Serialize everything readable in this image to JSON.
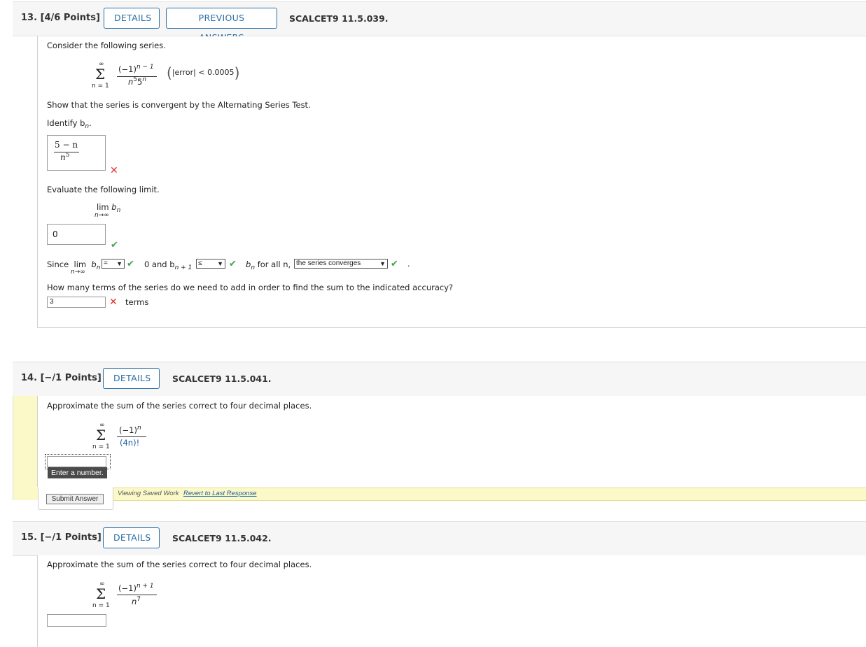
{
  "q13": {
    "number": "13.",
    "points": "[4/6 Points]",
    "details_label": "DETAILS",
    "prev_label": "PREVIOUS ANSWERS",
    "code": "SCALCET9 11.5.039.",
    "consider": "Consider the following series.",
    "series_num": "(−1)",
    "series_num_exp": "n − 1",
    "series_den": "n",
    "series_den_exp1": "5",
    "series_den_mid": "5",
    "series_den_exp2": "n",
    "sum_top": "∞",
    "sum_bottom": "n = 1",
    "error_text": "|error| < 0.0005",
    "show_text": "Show that the series is convergent by the Alternating Series Test.",
    "identify": "Identify b",
    "identify_sub": "n",
    "answer_bn_num": "5 − n",
    "answer_bn_den": "n",
    "answer_bn_den_exp": "5",
    "evaluate": "Evaluate the following limit.",
    "lim_word": "lim",
    "lim_b": "b",
    "lim_sub": "n",
    "lim_under": "n→∞",
    "limit_value": "0",
    "since": "Since",
    "since_lim": "lim",
    "since_b": "b",
    "since_sub": "n",
    "since_under": "n→∞",
    "select1": "=",
    "zero_and": "0 and b",
    "bn1_sub": "n + 1",
    "select2": "≤",
    "bn": "b",
    "bn_sub": "n",
    "for_all": "for all n,",
    "select3": "the series converges",
    "period": ".",
    "how_many": "How many terms of the series do we need to add in order to find the sum to the indicated accuracy?",
    "terms_value": "3",
    "terms_label": "terms"
  },
  "q14": {
    "number": "14.",
    "points": "[−/1 Points]",
    "details_label": "DETAILS",
    "code": "SCALCET9 11.5.041.",
    "prompt": "Approximate the sum of the series correct to four decimal places.",
    "sum_top": "∞",
    "sum_bottom": "n = 1",
    "num": "(−1)",
    "num_exp": "n",
    "den": "(4n)!",
    "tooltip": "Enter a number.",
    "submit_label": "Submit Answer",
    "saved_text": "Viewing Saved Work",
    "revert_link": "Revert to Last Response"
  },
  "q15": {
    "number": "15.",
    "points": "[−/1 Points]",
    "details_label": "DETAILS",
    "code": "SCALCET9 11.5.042.",
    "prompt": "Approximate the sum of the series correct to four decimal places.",
    "sum_top": "∞",
    "sum_bottom": "n = 1",
    "num": "(−1)",
    "num_exp": "n + 1",
    "den": "n",
    "den_exp": "7"
  }
}
